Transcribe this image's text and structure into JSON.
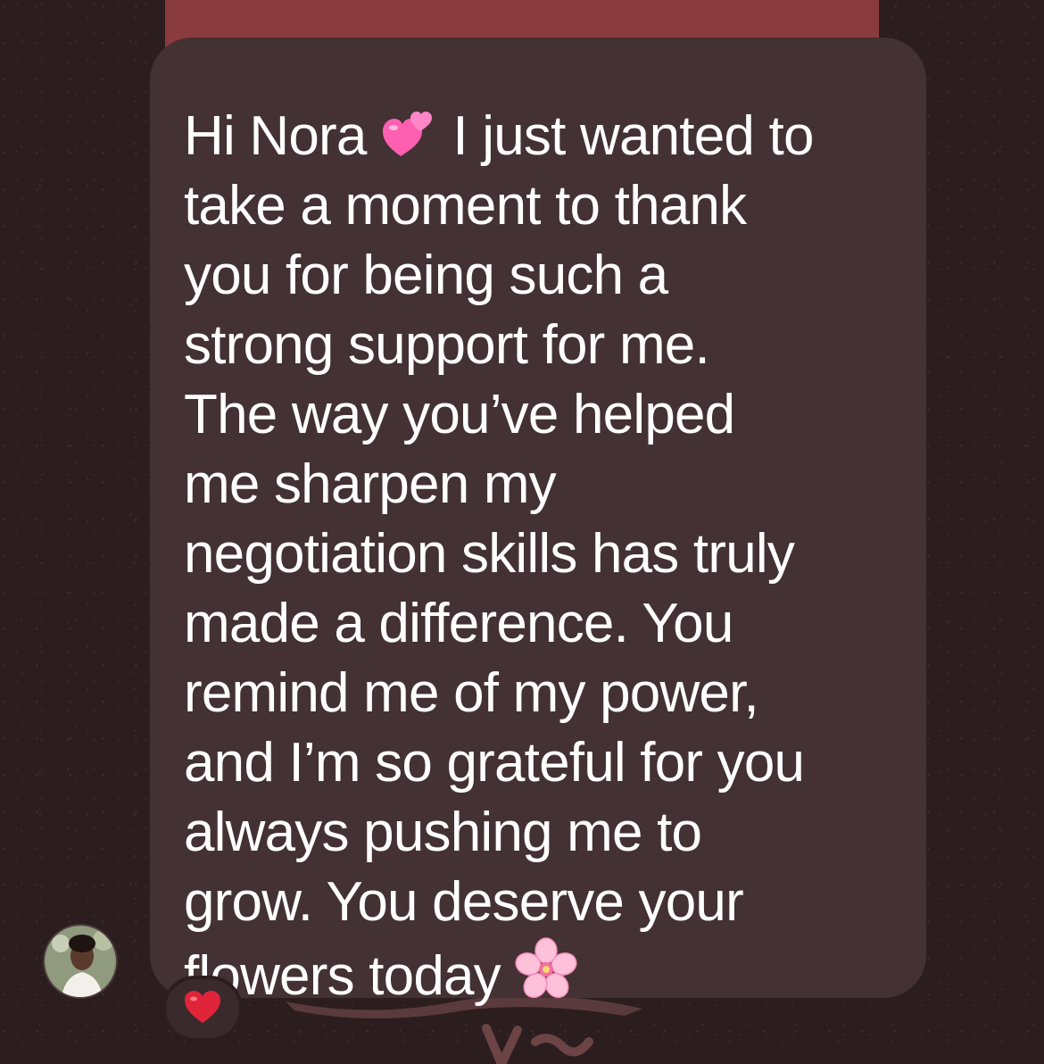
{
  "message": {
    "line1_pre": "Hi Nora ",
    "line1_emoji": "two-hearts-icon",
    "line1_post": " I just wanted to",
    "lines": [
      "take a moment to thank",
      "you for being such a",
      "strong support for me.",
      "The way you’ve helped",
      "me sharpen my",
      "negotiation skills has truly",
      "made a difference. You",
      "remind me of my power,",
      "and I’m so grateful for you",
      "always pushing me to",
      "grow. You deserve your"
    ],
    "last_line_pre": "flowers today ",
    "last_line_emoji": "cherry-blossom-icon"
  },
  "reaction": {
    "emoji": "red-heart-icon"
  },
  "avatar": {
    "icon": "avatar"
  },
  "colors": {
    "background": "#2c1d1f",
    "bubble": "#433133",
    "top_band": "#8a3b3d",
    "text": "#ffffff",
    "heart": "#e0243a",
    "pink_heart": "#ff5fb0",
    "blossom": "#ffc1da"
  }
}
